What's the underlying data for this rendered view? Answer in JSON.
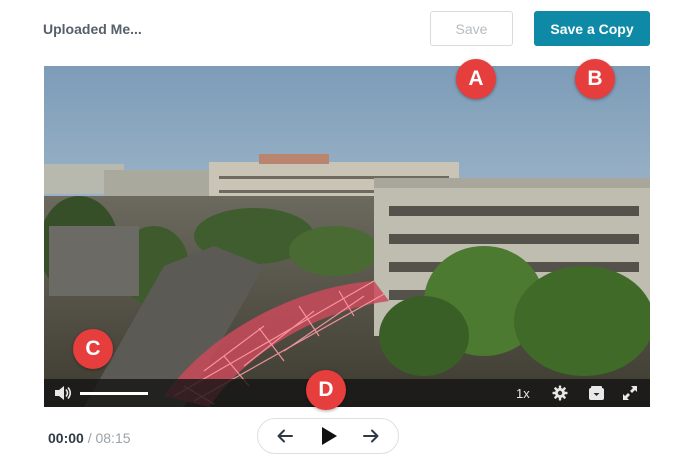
{
  "header": {
    "title": "Uploaded Me...",
    "save_label": "Save",
    "save_copy_label": "Save a Copy"
  },
  "markers": {
    "a": "A",
    "b": "B",
    "c": "C",
    "d": "D"
  },
  "player": {
    "speed": "1x",
    "volume_level": 1.0,
    "icons": [
      "volume-icon",
      "gear-icon",
      "captions-icon",
      "fullscreen-icon"
    ]
  },
  "playback": {
    "current_time": "00:00",
    "separator": "/",
    "duration": "08:15",
    "icons": [
      "arrow-left-icon",
      "play-icon",
      "arrow-right-icon"
    ]
  },
  "colors": {
    "accent": "#0f8aa6",
    "marker": "#e63d3d"
  }
}
